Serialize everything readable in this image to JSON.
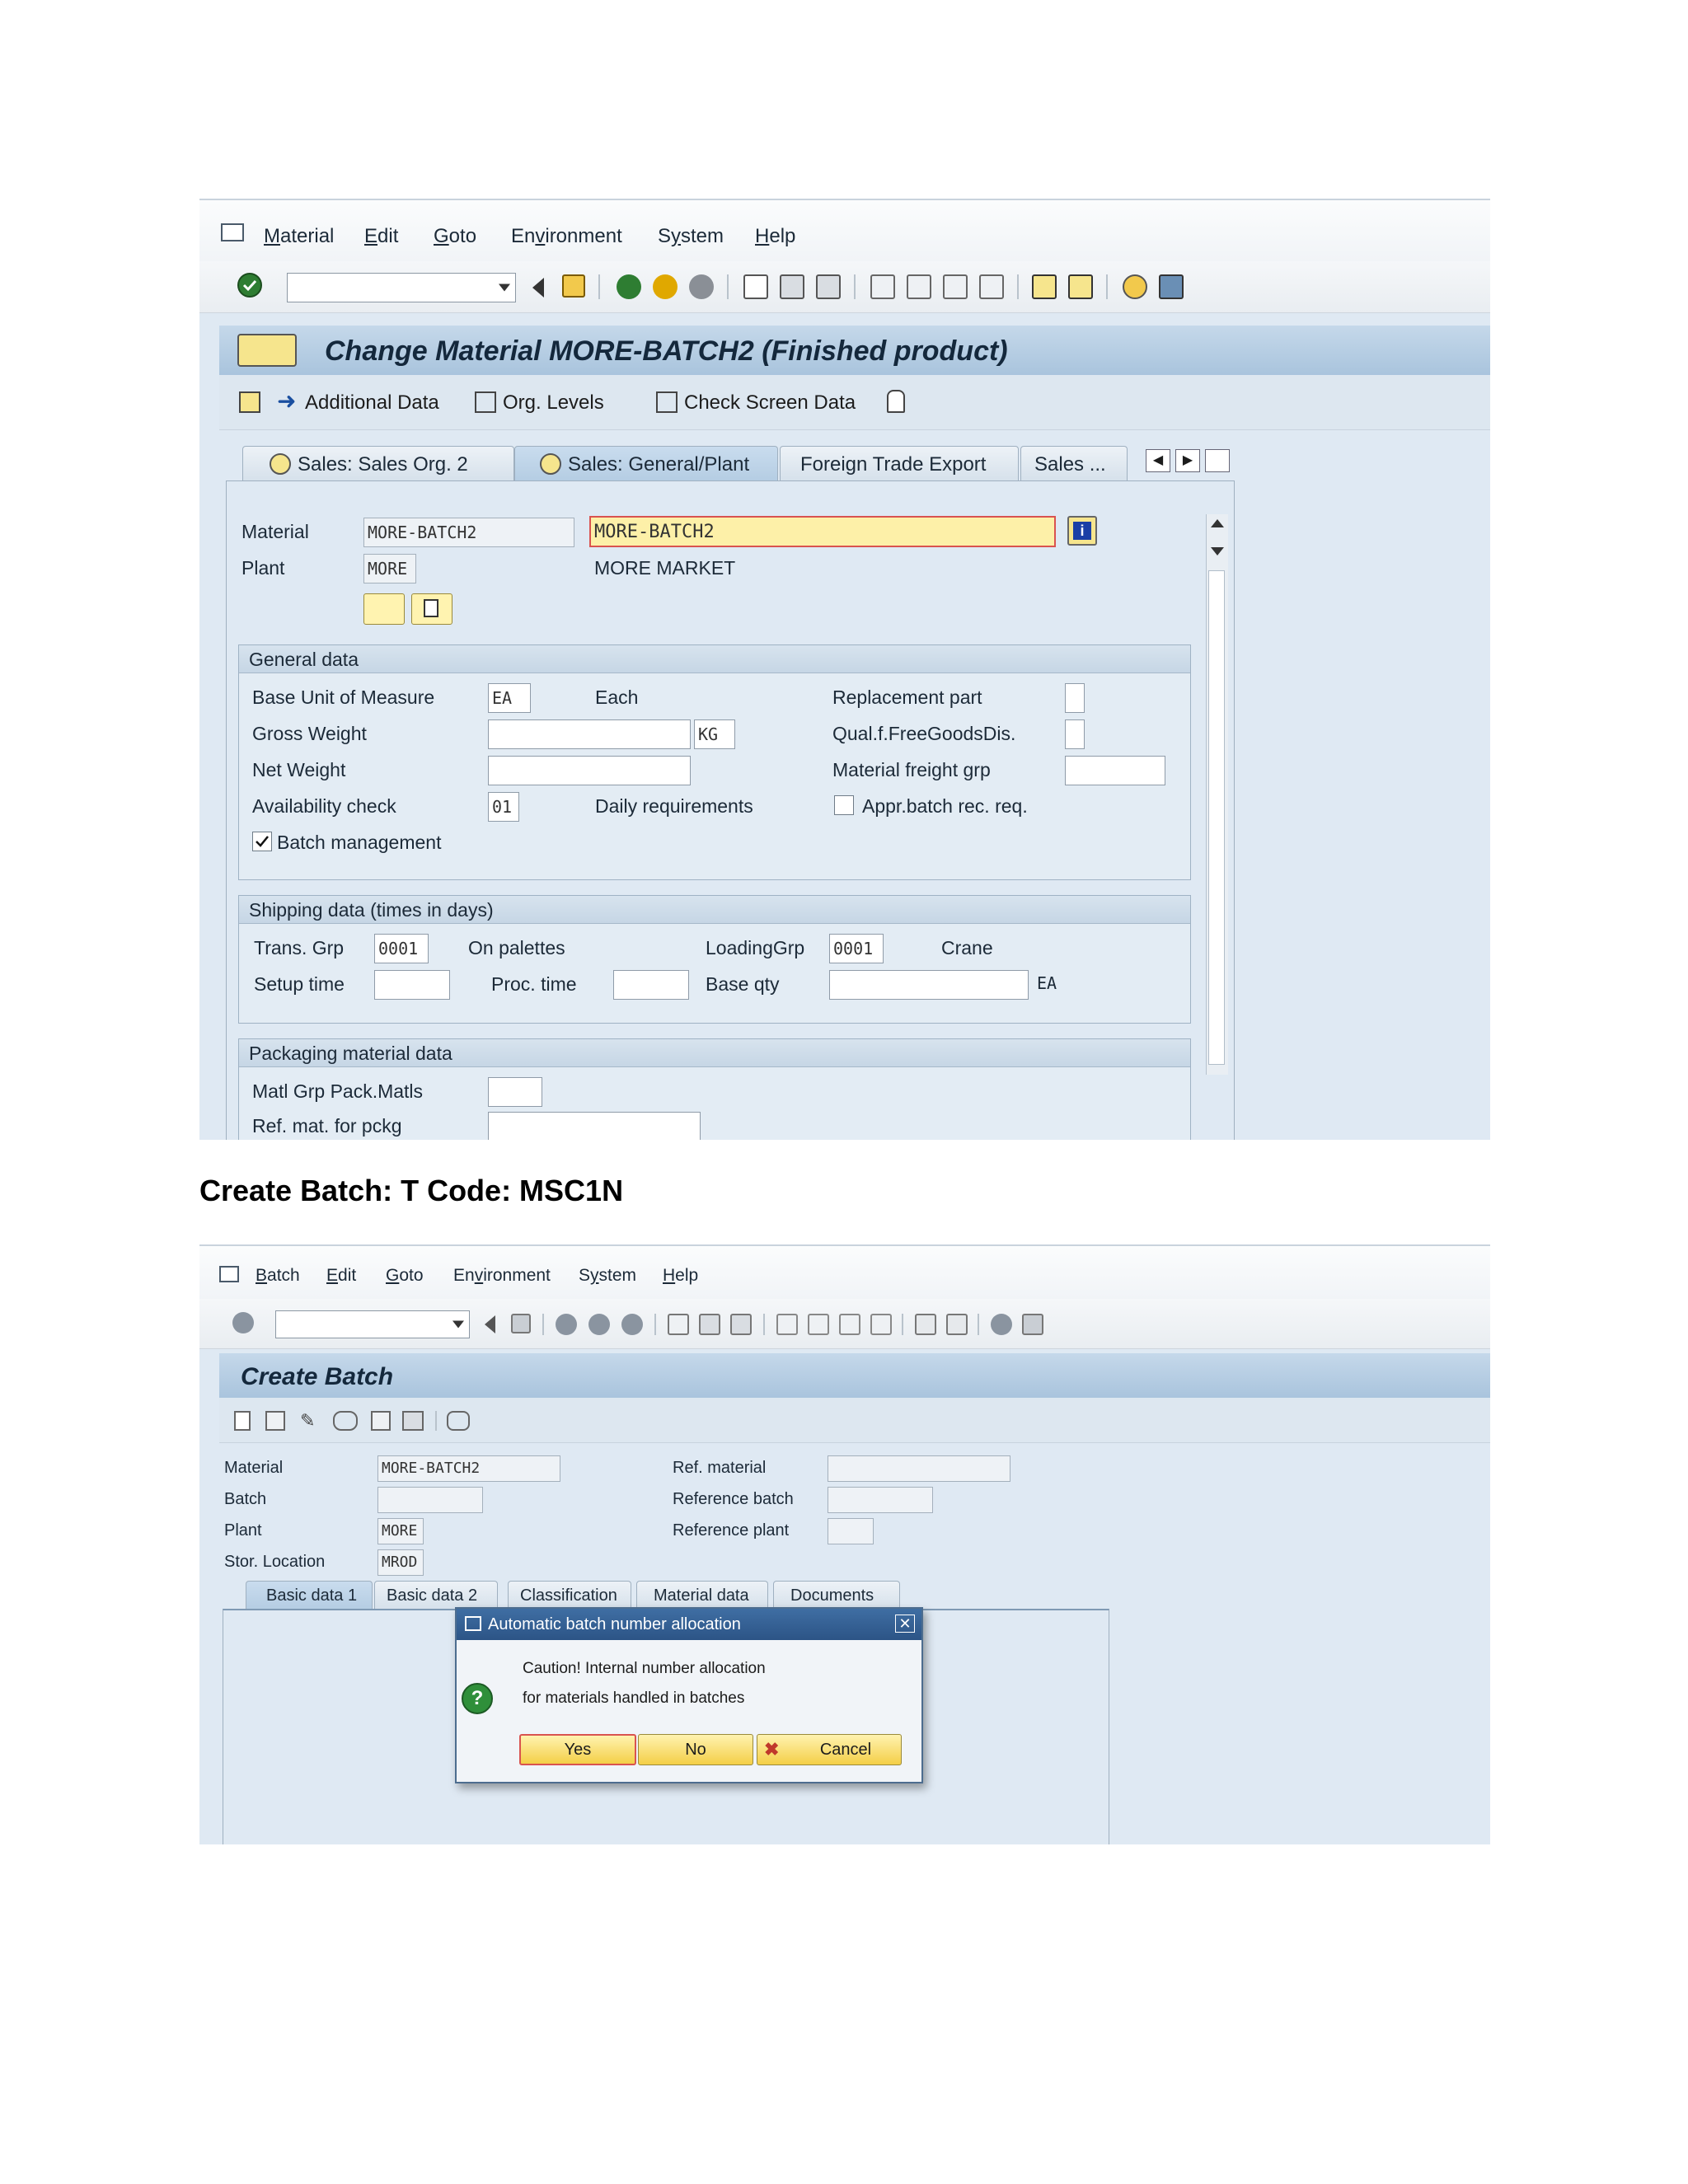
{
  "screen1": {
    "menu": [
      {
        "label": "Material",
        "key": "M"
      },
      {
        "label": "Edit",
        "key": "E"
      },
      {
        "label": "Goto",
        "key": "G"
      },
      {
        "label": "Environment",
        "key": "v"
      },
      {
        "label": "System",
        "key": "y"
      },
      {
        "label": "Help",
        "key": "H"
      }
    ],
    "title": "Change Material MORE-BATCH2 (Finished product)",
    "app_toolbar": {
      "additional_data": "Additional Data",
      "org_levels": "Org. Levels",
      "check_screen_data": "Check Screen Data"
    },
    "tabs": [
      "Sales: Sales Org. 2",
      "Sales: General/Plant",
      "Foreign Trade Export",
      "Sales ..."
    ],
    "header": {
      "material_label": "Material",
      "material_value": "MORE-BATCH2",
      "material_desc": "MORE-BATCH2",
      "plant_label": "Plant",
      "plant_value": "MORE",
      "plant_desc": "MORE MARKET"
    },
    "general_data": {
      "title": "General data",
      "base_uom_label": "Base Unit of Measure",
      "base_uom_value": "EA",
      "base_uom_text": "Each",
      "gross_weight_label": "Gross Weight",
      "weight_unit": "KG",
      "net_weight_label": "Net Weight",
      "availability_label": "Availability check",
      "availability_value": "01",
      "availability_text": "Daily requirements",
      "batch_mgmt_label": "Batch management",
      "replacement_part_label": "Replacement part",
      "qual_free_goods_label": "Qual.f.FreeGoodsDis.",
      "material_freight_label": "Material freight grp",
      "appr_batch_label": "Appr.batch rec. req."
    },
    "shipping_data": {
      "title": "Shipping data (times in days)",
      "trans_grp_label": "Trans. Grp",
      "trans_grp_value": "0001",
      "trans_grp_text": "On palettes",
      "loading_grp_label": "LoadingGrp",
      "loading_grp_value": "0001",
      "loading_grp_text": "Crane",
      "setup_time_label": "Setup time",
      "proc_time_label": "Proc. time",
      "base_qty_label": "Base qty",
      "base_qty_unit": "EA"
    },
    "packaging_data": {
      "title": "Packaging material data",
      "matl_grp_label": "Matl Grp Pack.Matls",
      "ref_mat_label": "Ref. mat. for pckg"
    }
  },
  "caption": "Create Batch: T Code: MSC1N",
  "screen2": {
    "menu": [
      {
        "label": "Batch",
        "key": "B"
      },
      {
        "label": "Edit",
        "key": "E"
      },
      {
        "label": "Goto",
        "key": "G"
      },
      {
        "label": "Environment",
        "key": "v"
      },
      {
        "label": "System",
        "key": "y"
      },
      {
        "label": "Help",
        "key": "H"
      }
    ],
    "title": "Create Batch",
    "fields": {
      "material_label": "Material",
      "material_value": "MORE-BATCH2",
      "batch_label": "Batch",
      "plant_label": "Plant",
      "plant_value": "MORE",
      "stor_loc_label": "Stor. Location",
      "stor_loc_value": "MROD",
      "ref_material_label": "Ref. material",
      "ref_batch_label": "Reference batch",
      "ref_plant_label": "Reference plant"
    },
    "tabs": [
      "Basic data 1",
      "Basic data 2",
      "Classification",
      "Material data",
      "Documents"
    ],
    "dialog": {
      "title": "Automatic batch number allocation",
      "line1": "Caution! Internal number allocation",
      "line2": "for materials handled in batches",
      "yes": "Yes",
      "no": "No",
      "cancel": "Cancel"
    }
  }
}
